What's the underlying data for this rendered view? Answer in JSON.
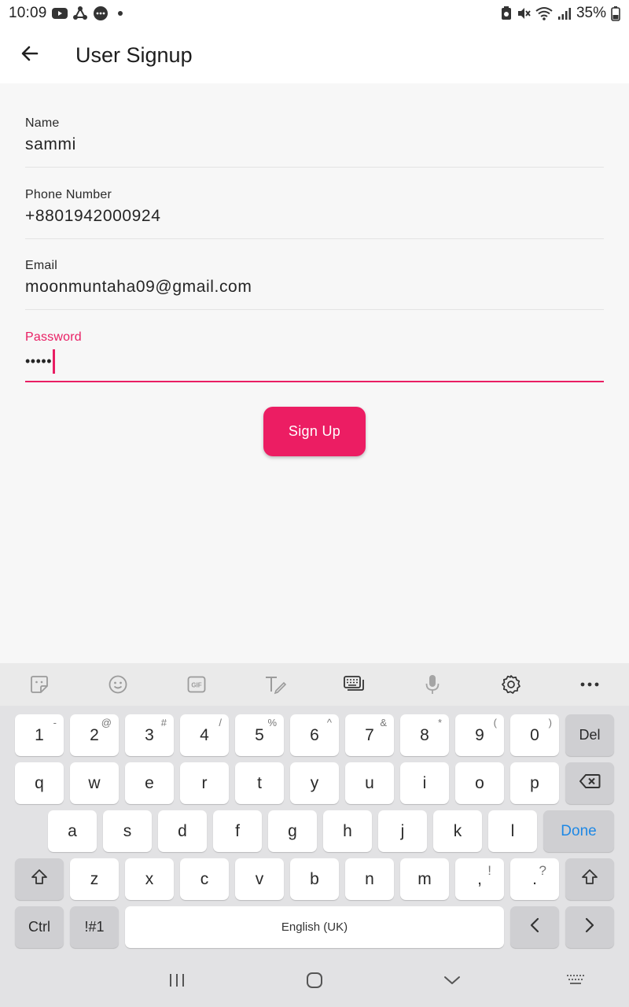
{
  "status_bar": {
    "time": "10:09",
    "battery_text": "35%",
    "left_icons": [
      "youtube-icon",
      "sync-icon",
      "messages-icon",
      "dot-icon"
    ],
    "right_icons": [
      "battery-saver-icon",
      "mute-icon",
      "wifi-icon",
      "signal-icon",
      "battery-icon"
    ]
  },
  "app_bar": {
    "title": "User Signup",
    "back_icon": "arrow-left-icon"
  },
  "form": {
    "fields": [
      {
        "label": "Name",
        "value": "sammi"
      },
      {
        "label": "Phone Number",
        "value": "+8801942000924"
      },
      {
        "label": "Email",
        "value": "moonmuntaha09@gmail.com"
      },
      {
        "label": "Password",
        "value": "•••••"
      }
    ],
    "submit_label": "Sign Up",
    "accent_color": "#e91e63"
  },
  "keyboard": {
    "toolbar": [
      "sticker-icon",
      "emoji-icon",
      "gif-icon",
      "handwriting-icon",
      "keyboard-mode-icon",
      "mic-icon",
      "settings-icon",
      "more-icon"
    ],
    "row1": [
      {
        "k": "1",
        "s": "-"
      },
      {
        "k": "2",
        "s": "@"
      },
      {
        "k": "3",
        "s": "#"
      },
      {
        "k": "4",
        "s": "/"
      },
      {
        "k": "5",
        "s": "%"
      },
      {
        "k": "6",
        "s": "^"
      },
      {
        "k": "7",
        "s": "&"
      },
      {
        "k": "8",
        "s": "*"
      },
      {
        "k": "9",
        "s": "("
      },
      {
        "k": "0",
        "s": ")"
      }
    ],
    "del_label": "Del",
    "row2": [
      "q",
      "w",
      "e",
      "r",
      "t",
      "y",
      "u",
      "i",
      "o",
      "p"
    ],
    "row3": [
      "a",
      "s",
      "d",
      "f",
      "g",
      "h",
      "j",
      "k",
      "l"
    ],
    "done_label": "Done",
    "row4": [
      "z",
      "x",
      "c",
      "v",
      "b",
      "n",
      "m"
    ],
    "comma_key": {
      "k": ",",
      "s": "!"
    },
    "period_key": {
      "k": ".",
      "s": "?"
    },
    "ctrl_label": "Ctrl",
    "symbols_label": "!#1",
    "space_label": "English (UK)",
    "done_color": "#1e88e5"
  },
  "nav_bar": [
    "recent-apps-icon",
    "home-icon",
    "back-icon",
    "keyboard-switch-icon"
  ]
}
